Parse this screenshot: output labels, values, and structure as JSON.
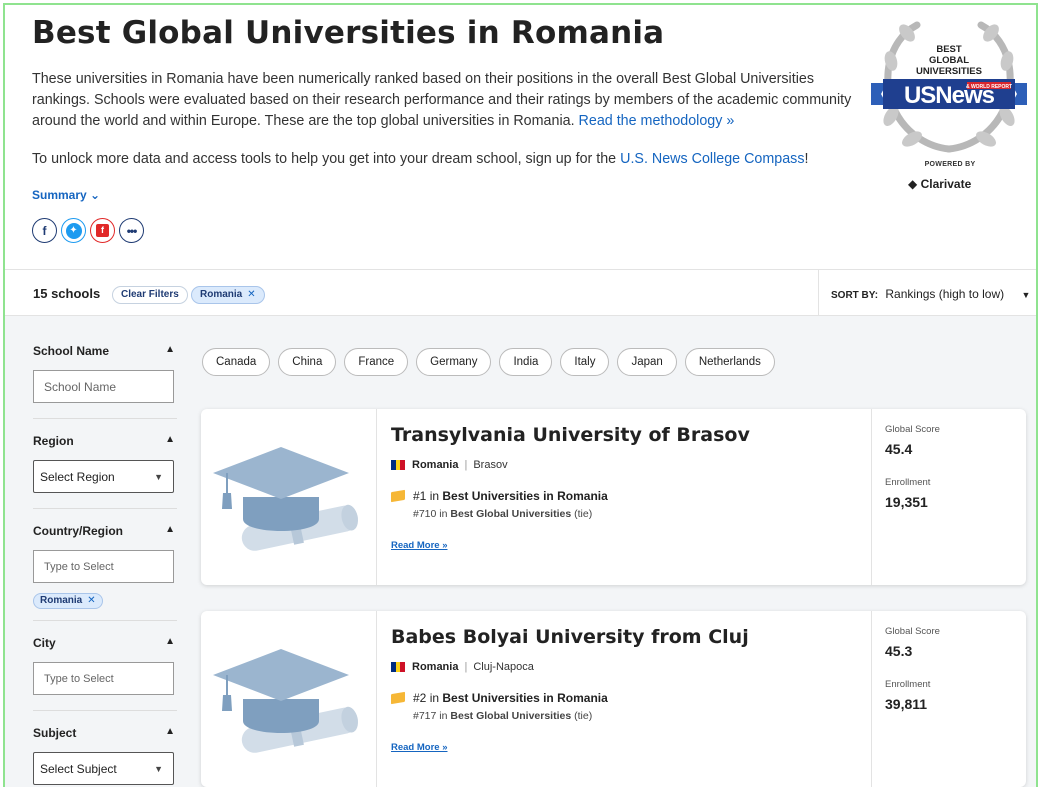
{
  "header": {
    "title": "Best Global Universities in Romania",
    "intro": "These universities in Romania have been numerically ranked based on their positions in the overall Best Global Universities rankings. Schools were evaluated based on their research performance and their ratings by members of the academic community around the world and within Europe. These are the top global universities in Romania.",
    "methodology_link": "Read the methodology »",
    "cta_text": "To unlock more data and access tools to help you get into your dream school, sign up for the",
    "cta_link": "U.S. News College Compass",
    "cta_end": "!",
    "summary_label": "Summary",
    "badge": {
      "line1": "BEST",
      "line2": "GLOBAL",
      "line3": "UNIVERSITIES",
      "brand": "USNews",
      "sub": "& WORLD REPORT"
    },
    "powered_by": "POWERED BY",
    "partner": "Clarivate"
  },
  "social": {
    "icons": [
      "facebook-icon",
      "twitter-icon",
      "flipboard-icon",
      "more-icon"
    ]
  },
  "filterbar": {
    "count": "15 schools",
    "clear_label": "Clear Filters",
    "active_filter": "Romania",
    "sort_label": "SORT BY:",
    "sort_value": "Rankings (high to low)"
  },
  "sidebar": {
    "school_name": {
      "label": "School Name",
      "placeholder": "School Name"
    },
    "region": {
      "label": "Region",
      "value": "Select Region"
    },
    "country": {
      "label": "Country/Region",
      "placeholder": "Type to Select",
      "tag": "Romania"
    },
    "city": {
      "label": "City",
      "placeholder": "Type to Select"
    },
    "subject": {
      "label": "Subject",
      "value": "Select Subject"
    }
  },
  "countries": [
    "Canada",
    "China",
    "France",
    "Germany",
    "India",
    "Italy",
    "Japan",
    "Netherlands"
  ],
  "cards": [
    {
      "name": "Transylvania University of Brasov",
      "country": "Romania",
      "city": "Brasov",
      "rank1_num": "#1",
      "rank1_in": "in",
      "rank1_list": "Best Universities in Romania",
      "rank2_num": "#710",
      "rank2_in": "in",
      "rank2_list": "Best Global Universities",
      "rank2_tie": "(tie)",
      "read_more": "Read More »",
      "score_label": "Global Score",
      "score": "45.4",
      "enroll_label": "Enrollment",
      "enrollment": "19,351"
    },
    {
      "name": "Babes Bolyai University from Cluj",
      "country": "Romania",
      "city": "Cluj-Napoca",
      "rank1_num": "#2",
      "rank1_in": "in",
      "rank1_list": "Best Universities in Romania",
      "rank2_num": "#717",
      "rank2_in": "in",
      "rank2_list": "Best Global Universities",
      "rank2_tie": "(tie)",
      "read_more": "Read More »",
      "score_label": "Global Score",
      "score": "45.3",
      "enroll_label": "Enrollment",
      "enrollment": "39,811"
    }
  ],
  "colors": {
    "link": "#1565c0",
    "accent_green": "#8fe38f",
    "cap": "#8aa9c7",
    "trophy": "#f6b736"
  }
}
